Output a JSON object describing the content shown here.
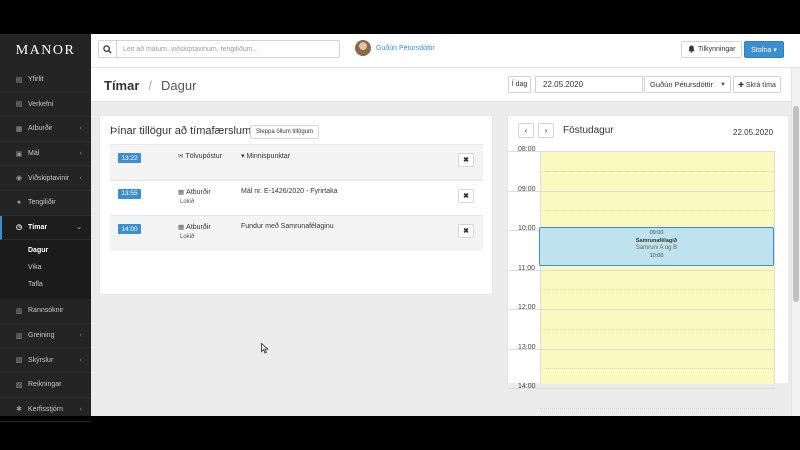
{
  "app": {
    "logo": "MANOR"
  },
  "sidebar": {
    "items": [
      {
        "label": "Yfirlit",
        "icon": "dashboard-icon",
        "glyph": "▤"
      },
      {
        "label": "Verkefni",
        "icon": "tasks-icon",
        "glyph": "▤"
      },
      {
        "label": "Atburðir",
        "icon": "calendar-icon",
        "glyph": "▦",
        "chevron": "‹"
      },
      {
        "label": "Mál",
        "icon": "briefcase-icon",
        "glyph": "▣",
        "chevron": "‹"
      },
      {
        "label": "Viðskiptavinir",
        "icon": "clients-icon",
        "glyph": "◉",
        "chevron": "‹"
      },
      {
        "label": "Tengiliðir",
        "icon": "contacts-icon",
        "glyph": "●"
      },
      {
        "label": "Tímar",
        "icon": "clock-icon",
        "glyph": "◷",
        "chevron": "⌄"
      }
    ],
    "sub_items": [
      {
        "label": "Dagur"
      },
      {
        "label": "Vika"
      },
      {
        "label": "Tafla"
      }
    ],
    "items_after": [
      {
        "label": "Rannsóknir",
        "icon": "research-icon",
        "glyph": "▥"
      },
      {
        "label": "Greining",
        "icon": "bar-chart-icon",
        "glyph": "▥",
        "chevron": "‹"
      },
      {
        "label": "Skýrslur",
        "icon": "reports-icon",
        "glyph": "▧",
        "chevron": "‹"
      },
      {
        "label": "Reikningar",
        "icon": "invoice-icon",
        "glyph": "▨"
      },
      {
        "label": "Kerfisstjórn",
        "icon": "gear-icon",
        "glyph": "✱",
        "chevron": "‹"
      }
    ]
  },
  "topbar": {
    "search_placeholder": "Leit að málum, viðskiptavinum, tengiliðum...",
    "user_name": "Guðún Pétursdóttir",
    "notifications_label": "Tilkynningar",
    "create_label": "Stofna ▾"
  },
  "pagehead": {
    "title": "Tímar",
    "separator": "/",
    "current": "Dagur",
    "today_label": "Í dag",
    "date_value": "22.05.2020",
    "user_select": "Guðún Pétursdóttir",
    "add_time_label": "✚ Skrá tíma"
  },
  "suggestions": {
    "title": "Þínar tillögur að tímafærslum",
    "skip_all_label": "Sleppa öllum tillögum",
    "rows": [
      {
        "time": "13:22",
        "type_icon": "✉",
        "type": "Tölvupóstur",
        "status": "",
        "desc": "▾ Minnispunktar"
      },
      {
        "time": "13:55",
        "type_icon": "▦",
        "type": "Atburðir",
        "status": "Lokið",
        "desc": "Mál nr. E-1426/2020 - Fyrirtaka"
      },
      {
        "time": "14:00",
        "type_icon": "▦",
        "type": "Atburðir",
        "status": "Lokið",
        "desc": "Fundur með Samrunafélaginu"
      }
    ],
    "dismiss_glyph": "✖"
  },
  "calendar": {
    "prev": "‹",
    "next": "›",
    "day_name": "Föstudagur",
    "date": "22.05.2020",
    "hours": [
      "08:00",
      "09:00",
      "10:00",
      "11:00",
      "12:00",
      "13:00",
      "14:00"
    ],
    "event": {
      "start": "09:00",
      "title": "Samrunafélagið",
      "subtitle": "Samruni A og B",
      "end": "10:00"
    }
  },
  "colors": {
    "accent": "#3b8fd0",
    "sidebar_bg": "#242424",
    "calendar_day_bg": "#fbf8c0",
    "event_bg": "#bee2ee"
  }
}
